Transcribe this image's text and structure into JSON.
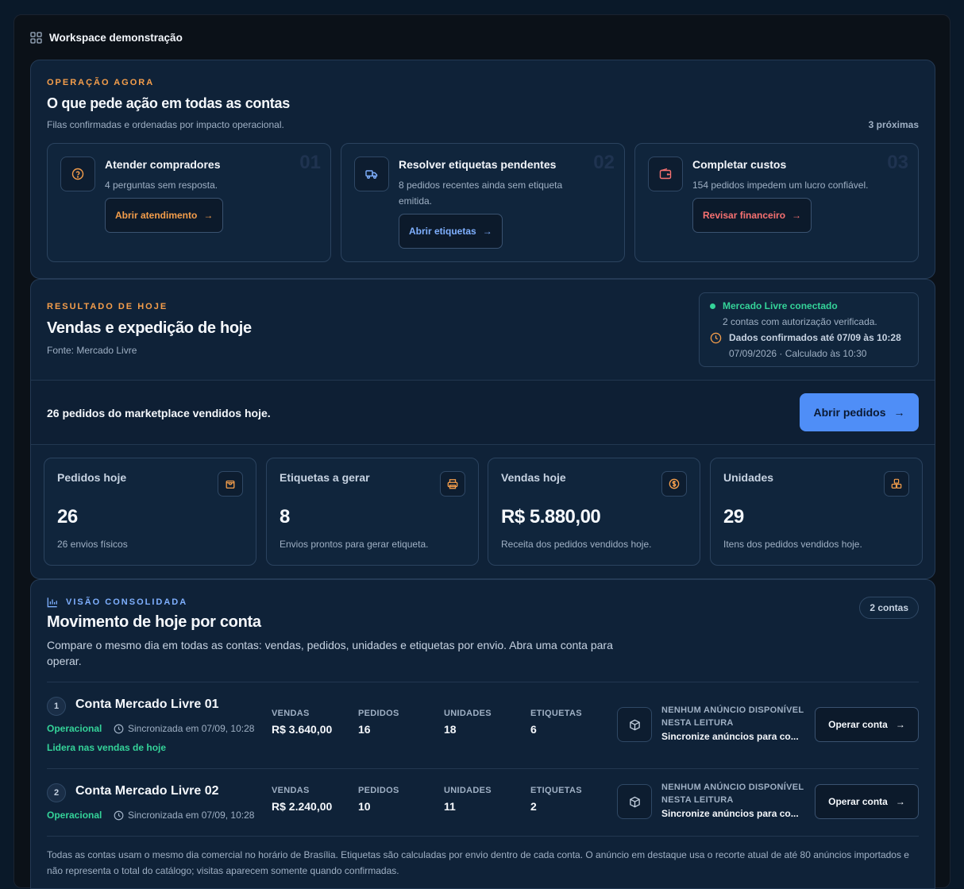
{
  "workspace": {
    "title": "Workspace demonstração",
    "icon": "grid-icon"
  },
  "operation": {
    "eyebrow": "OPERAÇÃO AGORA",
    "title": "O que pede ação em todas as contas",
    "subtitle": "Filas confirmadas e ordenadas por impacto operacional.",
    "count": "3 próximas",
    "actions": [
      {
        "num": "01",
        "title": "Atender compradores",
        "desc": "4 perguntas sem resposta.",
        "button": "Abrir atendimento",
        "icon": "question-circle-icon",
        "color": "#f59e4b"
      },
      {
        "num": "02",
        "title": "Resolver etiquetas pendentes",
        "desc": "8 pedidos recentes ainda sem etiqueta emitida.",
        "button": "Abrir etiquetas",
        "icon": "truck-icon",
        "color": "#7fb0ff"
      },
      {
        "num": "03",
        "title": "Completar custos",
        "desc": "154 pedidos impedem um lucro confiável.",
        "button": "Revisar financeiro",
        "icon": "wallet-icon",
        "color": "#f87171"
      }
    ]
  },
  "today": {
    "eyebrow": "RESULTADO DE HOJE",
    "title": "Vendas e expedição de hoje",
    "source": "Fonte: Mercado Livre",
    "connection": {
      "status": "Mercado Livre conectado",
      "status_detail": "2 contas com autorização verificada.",
      "confirmed": "Dados confirmados até 07/09 às 10:28",
      "confirmed_detail": "07/09/2026 · Calculado às 10:30"
    },
    "summary": "26 pedidos do marketplace vendidos hoje.",
    "open_orders": "Abrir pedidos",
    "kpis": [
      {
        "label": "Pedidos hoje",
        "value": "26",
        "sub": "26 envios físicos",
        "icon": "bag-icon"
      },
      {
        "label": "Etiquetas a gerar",
        "value": "8",
        "sub": "Envios prontos para gerar etiqueta.",
        "icon": "printer-icon"
      },
      {
        "label": "Vendas hoje",
        "value": "R$ 5.880,00",
        "sub": "Receita dos pedidos vendidos hoje.",
        "icon": "dollar-icon"
      },
      {
        "label": "Unidades",
        "value": "29",
        "sub": "Itens dos pedidos vendidos hoje.",
        "icon": "boxes-icon"
      }
    ]
  },
  "consolidated": {
    "eyebrow": "VISÃO CONSOLIDADA",
    "title": "Movimento de hoje por conta",
    "desc": "Compare o mesmo dia em todas as contas: vendas, pedidos, unidades e etiquetas por envio. Abra uma conta para operar.",
    "badge": "2 contas",
    "headers": {
      "sales": "VENDAS",
      "orders": "PEDIDOS",
      "units": "UNIDADES",
      "labels": "ETIQUETAS"
    },
    "accounts": [
      {
        "idx": "1",
        "name": "Conta Mercado Livre 01",
        "status": "Operacional",
        "sync": "Sincronizada em 07/09, 10:28",
        "lead": "Lidera nas vendas de hoje",
        "sales": "R$ 3.640,00",
        "orders": "16",
        "units": "18",
        "labels": "6",
        "listing_title": "NENHUM ANÚNCIO DISPONÍVEL NESTA LEITURA",
        "listing_action": "Sincronize anúncios para co...",
        "button": "Operar conta"
      },
      {
        "idx": "2",
        "name": "Conta Mercado Livre 02",
        "status": "Operacional",
        "sync": "Sincronizada em 07/09, 10:28",
        "lead": "",
        "sales": "R$ 2.240,00",
        "orders": "10",
        "units": "11",
        "labels": "2",
        "listing_title": "NENHUM ANÚNCIO DISPONÍVEL NESTA LEITURA",
        "listing_action": "Sincronize anúncios para co...",
        "button": "Operar conta"
      }
    ],
    "footnote": "Todas as contas usam o mesmo dia comercial no horário de Brasília. Etiquetas são calculadas por envio dentro de cada conta. O anúncio em destaque usa o recorte atual de até 80 anúncios importados e não representa o total do catálogo; visitas aparecem somente quando confirmadas."
  }
}
